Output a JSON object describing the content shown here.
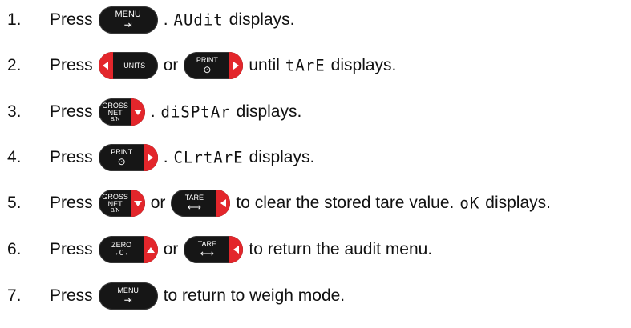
{
  "steps": [
    {
      "number": "1.",
      "press": "Press",
      "key1": {
        "top": "MENU",
        "glyph": "⇥"
      },
      "after1": ".",
      "display": "AUdit",
      "tail": "displays."
    },
    {
      "number": "2.",
      "press": "Press",
      "key1": {
        "label": "UNITS"
      },
      "or": "or",
      "key2": {
        "top": "PRINT",
        "glyph": "⊙"
      },
      "before": "until",
      "display": "tArE",
      "tail": "displays."
    },
    {
      "number": "3.",
      "press": "Press",
      "key1": {
        "l1": "GROSS",
        "l2": "NET",
        "l3": "B/N"
      },
      "after1": ".",
      "display": "diSPtAr",
      "tail": "displays."
    },
    {
      "number": "4.",
      "press": "Press",
      "key1": {
        "top": "PRINT",
        "glyph": "⊙"
      },
      "after1": ".",
      "display": "CLrtArE",
      "tail": "displays."
    },
    {
      "number": "5.",
      "press": "Press",
      "key1": {
        "l1": "GROSS",
        "l2": "NET",
        "l3": "B/N"
      },
      "or": "or",
      "key2": {
        "top": "TARE",
        "glyph": "⟷"
      },
      "text": "to clear the stored tare value.",
      "display": "oK",
      "tail": "displays."
    },
    {
      "number": "6.",
      "press": "Press",
      "key1": {
        "top": "ZERO",
        "glyph": "→0←"
      },
      "or": "or",
      "key2": {
        "top": "TARE",
        "glyph": "⟷"
      },
      "text": "to return the audit menu."
    },
    {
      "number": "7.",
      "press": "Press",
      "key1": {
        "top": "MENU",
        "glyph": "⇥"
      },
      "text": "to return to weigh mode."
    }
  ],
  "colors": {
    "key_body": "#161616",
    "key_arrow": "#e3262b"
  },
  "icons": [
    "menu-enter-icon",
    "arrow-left-icon",
    "arrow-right-icon",
    "arrow-down-icon",
    "arrow-up-icon",
    "print-icon",
    "tare-icon",
    "zero-icon"
  ]
}
